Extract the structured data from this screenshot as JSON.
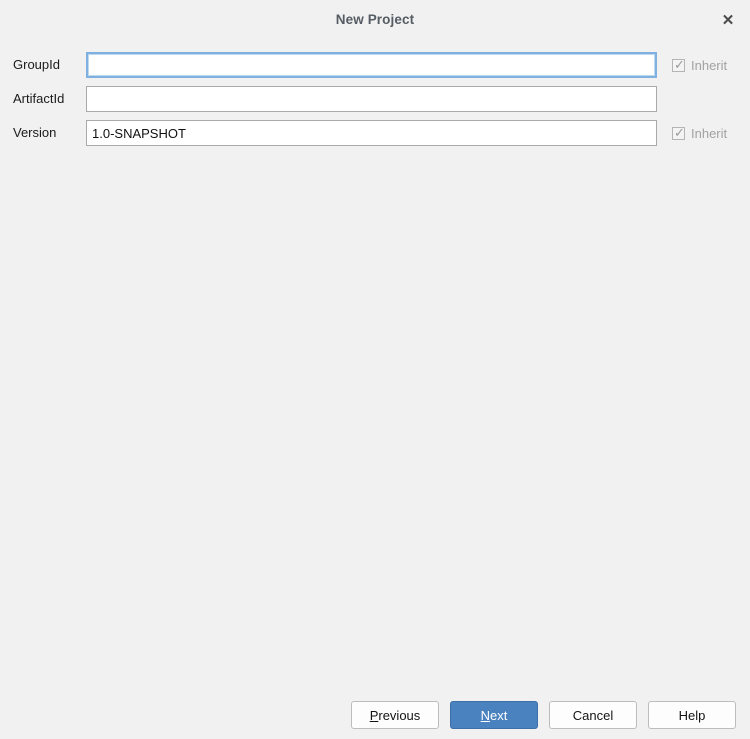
{
  "window": {
    "title": "New Project",
    "close_icon": "close-icon",
    "close_glyph": "✕"
  },
  "form": {
    "fields": [
      {
        "label": "GroupId",
        "value": "",
        "placeholder": "",
        "focused": true,
        "inherit": {
          "label": "Inherit",
          "checked": true,
          "enabled": false,
          "glyph": "✓"
        }
      },
      {
        "label": "ArtifactId",
        "value": "",
        "placeholder": "",
        "focused": false,
        "inherit": null
      },
      {
        "label": "Version",
        "value": "1.0-SNAPSHOT",
        "placeholder": "",
        "focused": false,
        "inherit": {
          "label": "Inherit",
          "checked": true,
          "enabled": false,
          "glyph": "✓"
        }
      }
    ]
  },
  "buttons": {
    "previous": {
      "prefix": "",
      "mnemonic": "P",
      "suffix": "revious"
    },
    "next": {
      "prefix": "",
      "mnemonic": "N",
      "suffix": "ext"
    },
    "cancel": {
      "label": "Cancel"
    },
    "help": {
      "label": "Help"
    }
  },
  "colors": {
    "background": "#f1f1f1",
    "accent": "#4a81bf",
    "focus_border": "#7fb0e0",
    "disabled_text": "#a2a2a2",
    "title_text": "#565c63"
  }
}
